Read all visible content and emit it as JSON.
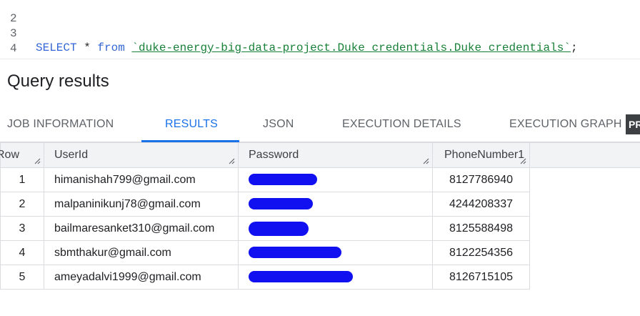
{
  "editor": {
    "lines": [
      {
        "num": "2",
        "keyword": "",
        "middle": "",
        "table_ref": "",
        "end": ""
      },
      {
        "num": "3",
        "keyword": "SELECT",
        "middle": " * ",
        "from_kw": "from",
        "table_ref": "`duke-energy-big-data-project.Duke_credentials.Duke_credentials`",
        "end": ";"
      },
      {
        "num": "4",
        "keyword": "",
        "middle": "",
        "table_ref": "",
        "end": ""
      }
    ]
  },
  "results": {
    "title": "Query results",
    "tabs": [
      {
        "label": "JOB INFORMATION"
      },
      {
        "label": "RESULTS"
      },
      {
        "label": "JSON"
      },
      {
        "label": "EXECUTION DETAILS"
      },
      {
        "label": "EXECUTION GRAPH"
      }
    ],
    "badge": "PR"
  },
  "table": {
    "columns": [
      "Row",
      "UserId",
      "Password",
      "PhoneNumber1"
    ],
    "rows": [
      {
        "row": "1",
        "userid": "himanishah799@gmail.com",
        "phone": "8127786940"
      },
      {
        "row": "2",
        "userid": "malpaninikunj78@gmail.com",
        "phone": "4244208337"
      },
      {
        "row": "3",
        "userid": "bailmaresanket310@gmail.com",
        "phone": "8125588498"
      },
      {
        "row": "4",
        "userid": "sbmthakur@gmail.com",
        "phone": "8122254356"
      },
      {
        "row": "5",
        "userid": "ameyadalvi1999@gmail.com",
        "phone": "8126715105"
      }
    ]
  },
  "colors": {
    "accent": "#1a73e8",
    "redaction": "#1010f0",
    "keyword": "#3367d6",
    "string": "#188038"
  }
}
